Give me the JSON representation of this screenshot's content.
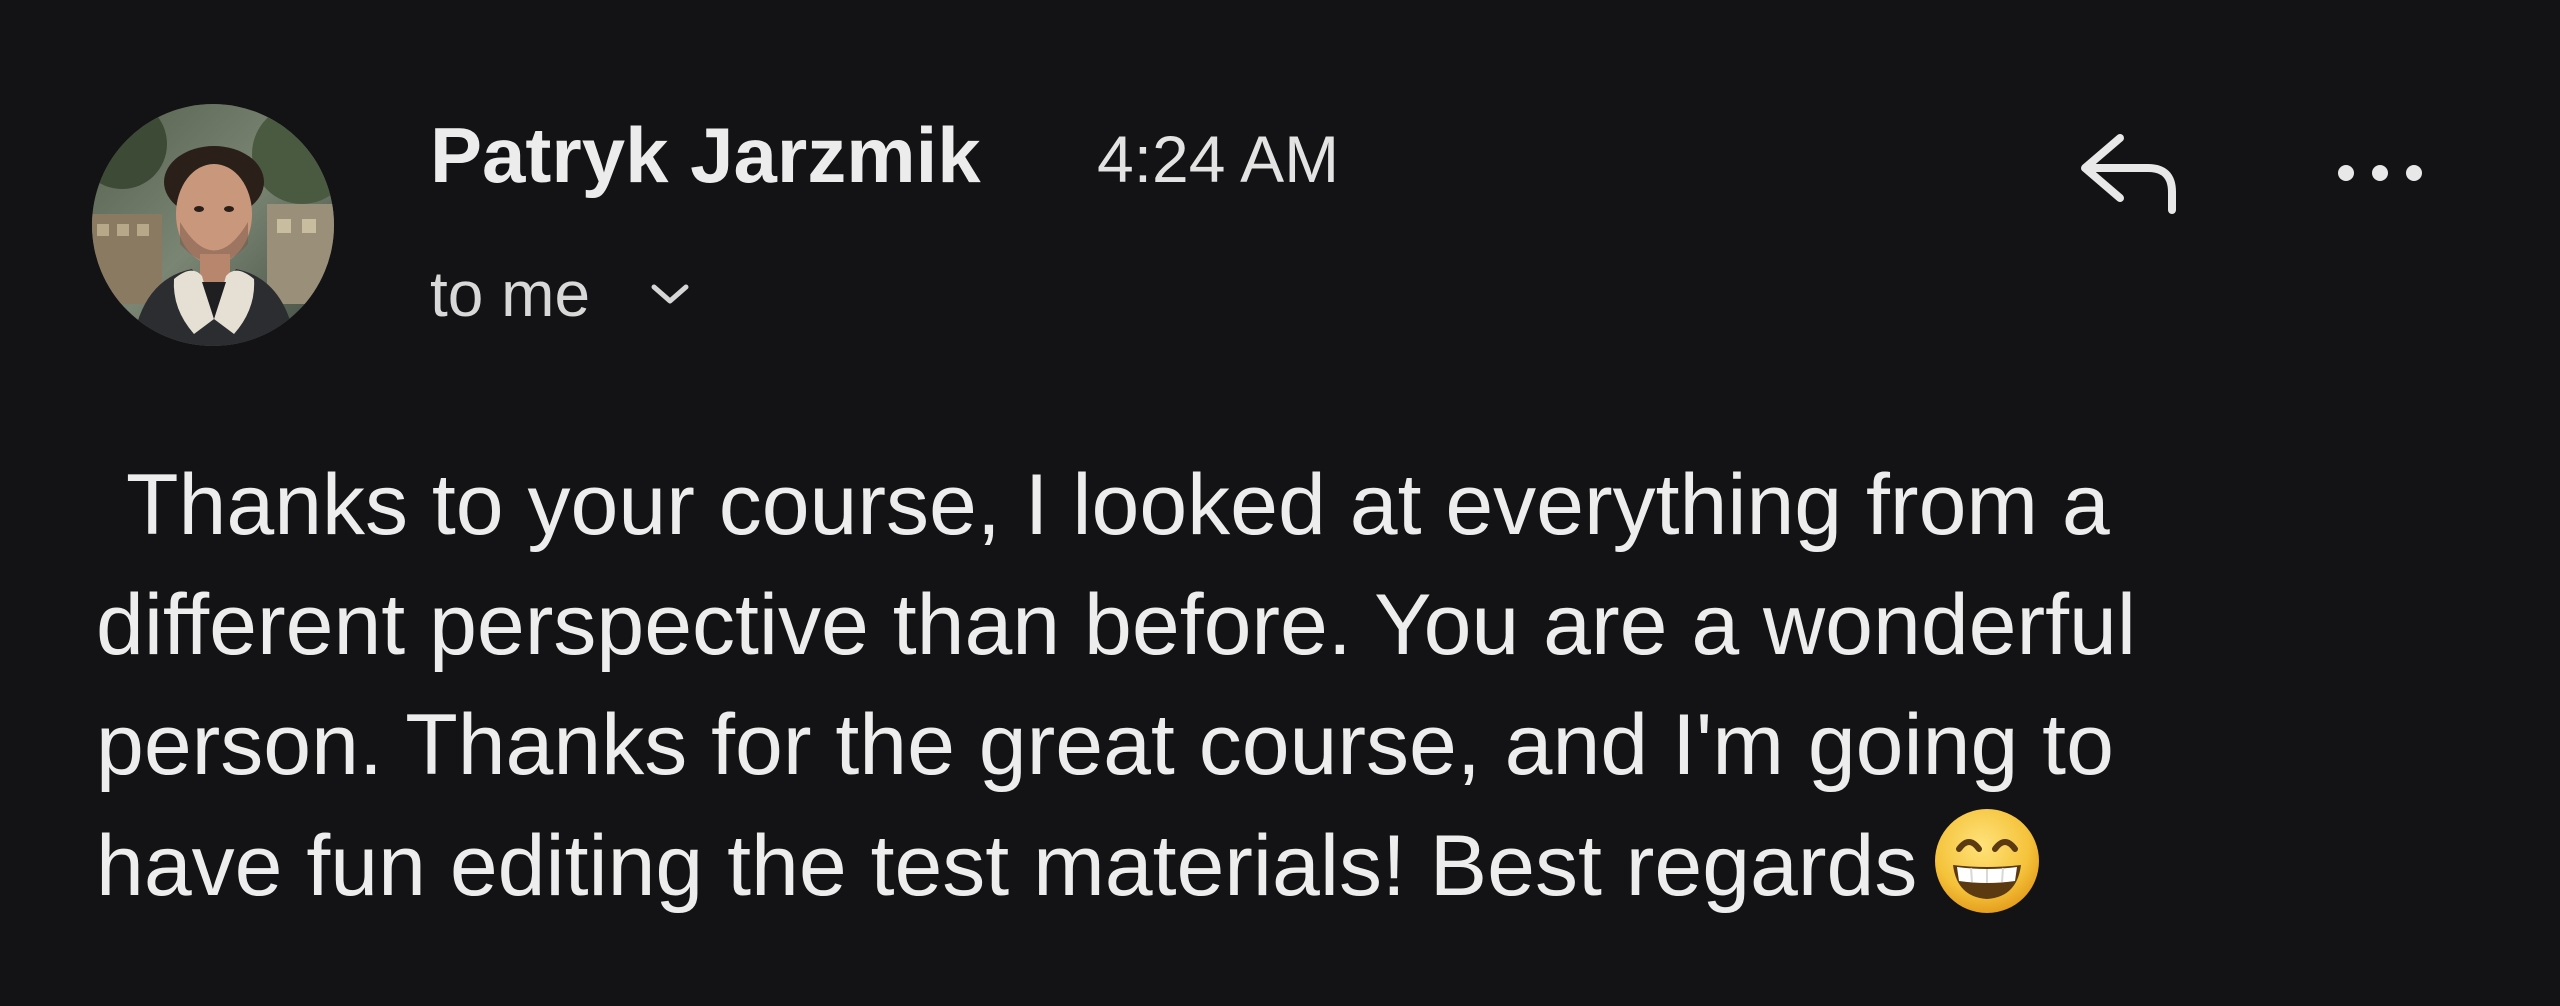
{
  "sender": {
    "name": "Patryk Jarzmik",
    "avatar": "sender-avatar-photo"
  },
  "timestamp": "4:24 AM",
  "recipient": {
    "label": "to me",
    "icon": "chevron-down-icon"
  },
  "actions": {
    "reply_icon": "reply-icon",
    "more_icon": "more-horizontal-icon"
  },
  "body": {
    "lines": [
      "Thanks to your course, I looked at everything from a",
      "different perspective than before. You are a wonderful",
      "person. Thanks for the great course, and I'm going to",
      "have fun editing the test materials! Best regards"
    ],
    "emoji": "grinning-face-with-smiling-eyes"
  },
  "colors": {
    "background": "#131315",
    "text": "#ededed",
    "icon": "#e8e8e8",
    "emoji_face": "#f5c33b"
  }
}
